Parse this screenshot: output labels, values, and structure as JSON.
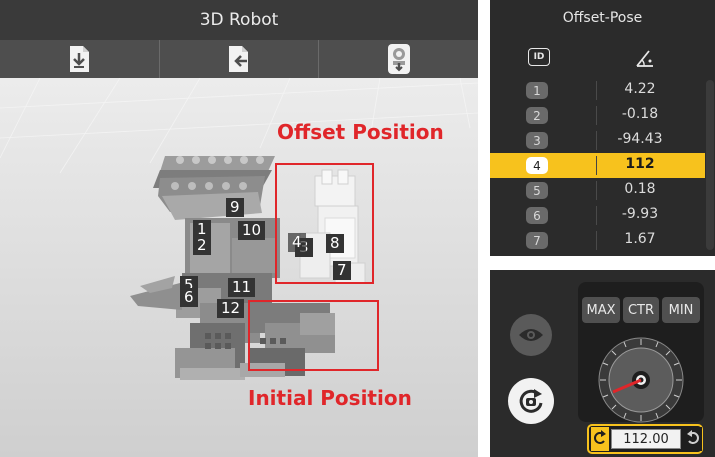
{
  "app": {
    "title": "3D Robot"
  },
  "toolbar": {
    "buttons": [
      {
        "icon": "download-icon"
      },
      {
        "icon": "export-icon"
      },
      {
        "icon": "robot-download-icon"
      }
    ]
  },
  "viewport": {
    "annotations": {
      "offset": "Offset Position",
      "initial": "Initial Position"
    },
    "joint_labels": [
      "1",
      "2",
      "3",
      "4",
      "5",
      "6",
      "7",
      "8",
      "9",
      "10",
      "11",
      "12"
    ]
  },
  "offset_pose": {
    "title": "Offset-Pose",
    "header": {
      "id_icon": "ID",
      "angle_icon": "angle-icon"
    },
    "rows": [
      {
        "id": "1",
        "value": "4.22"
      },
      {
        "id": "2",
        "value": "-0.18"
      },
      {
        "id": "3",
        "value": "-94.43"
      },
      {
        "id": "4",
        "value": "112"
      },
      {
        "id": "5",
        "value": "0.18"
      },
      {
        "id": "6",
        "value": "-9.93"
      },
      {
        "id": "7",
        "value": "1.67"
      }
    ],
    "selected_id": "4"
  },
  "control": {
    "buttons": {
      "max": "MAX",
      "ctr": "CTR",
      "min": "MIN"
    },
    "value": "112.00"
  },
  "colors": {
    "accent": "#f7c21d",
    "annotation": "#e0262a",
    "panel": "#2b2b2b"
  }
}
